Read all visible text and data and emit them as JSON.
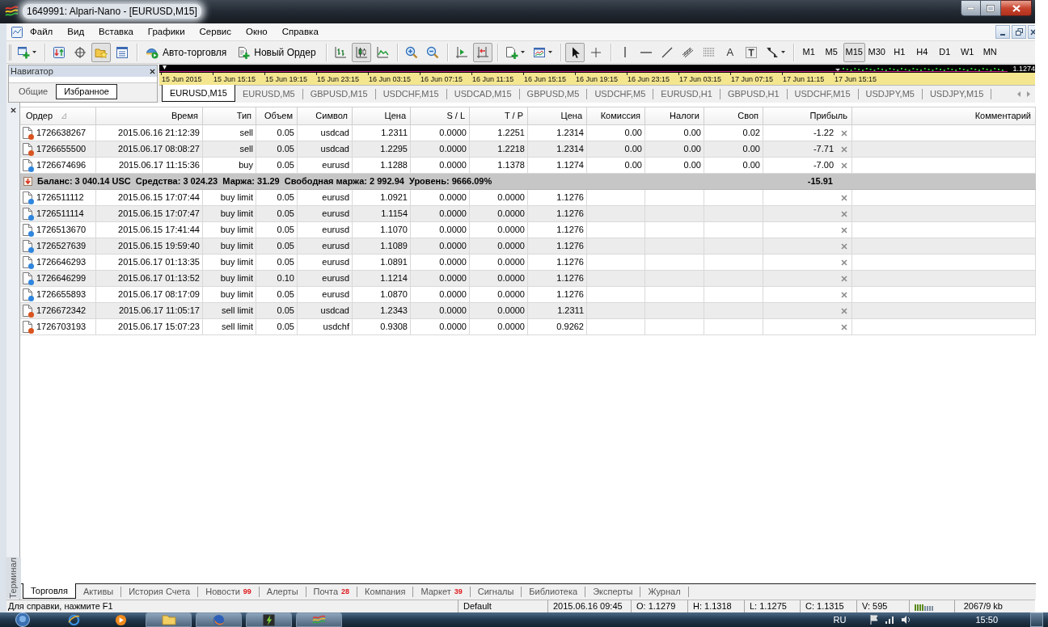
{
  "window": {
    "title": "1649991: Alpari-Nano - [EURUSD,M15]"
  },
  "menu": [
    "Файл",
    "Вид",
    "Вставка",
    "Графики",
    "Сервис",
    "Окно",
    "Справка"
  ],
  "toolbar": {
    "groups": [
      [
        {
          "kind": "icon",
          "pressed": false,
          "dropdown": true
        }
      ],
      [
        {
          "kind": "icon",
          "pressed": false,
          "dropdown": false
        },
        {
          "kind": "icon",
          "pressed": false,
          "dropdown": false
        },
        {
          "kind": "icon",
          "pressed": true,
          "dropdown": false
        },
        {
          "kind": "icon",
          "pressed": false,
          "dropdown": false
        }
      ],
      [
        {
          "kind": "text",
          "label": "Авто-торговля",
          "pressed": false
        },
        {
          "kind": "text",
          "label": "Новый Ордер",
          "pressed": false
        }
      ],
      [
        {
          "kind": "icon",
          "pressed": false,
          "dropdown": false
        },
        {
          "kind": "icon",
          "pressed": true,
          "dropdown": false
        },
        {
          "kind": "icon",
          "pressed": false,
          "dropdown": false
        }
      ],
      [
        {
          "kind": "icon",
          "pressed": false,
          "dropdown": false
        },
        {
          "kind": "icon",
          "pressed": false,
          "dropdown": false
        }
      ],
      [
        {
          "kind": "icon",
          "pressed": false,
          "dropdown": false
        },
        {
          "kind": "icon",
          "pressed": true,
          "dropdown": false
        }
      ],
      [
        {
          "kind": "icon",
          "pressed": false,
          "dropdown": true
        },
        {
          "kind": "icon",
          "pressed": false,
          "dropdown": true
        }
      ],
      [
        {
          "kind": "icon",
          "pressed": true,
          "dropdown": false
        },
        {
          "kind": "icon",
          "pressed": false,
          "dropdown": false
        }
      ],
      [
        {
          "kind": "icon",
          "pressed": false,
          "dropdown": false
        },
        {
          "kind": "icon",
          "pressed": false,
          "dropdown": false
        },
        {
          "kind": "icon",
          "pressed": false,
          "dropdown": false
        },
        {
          "kind": "icon",
          "pressed": false,
          "dropdown": false
        },
        {
          "kind": "icon",
          "pressed": false,
          "dropdown": false
        },
        {
          "kind": "glyph",
          "label": "A",
          "pressed": false
        },
        {
          "kind": "icon",
          "pressed": false,
          "dropdown": false
        },
        {
          "kind": "icon",
          "pressed": false,
          "dropdown": true
        }
      ],
      [
        {
          "kind": "timeframe",
          "label": "M1",
          "selected": false
        },
        {
          "kind": "timeframe",
          "label": "M5",
          "selected": false
        },
        {
          "kind": "timeframe",
          "label": "M15",
          "selected": true
        },
        {
          "kind": "timeframe",
          "label": "M30",
          "selected": false
        },
        {
          "kind": "timeframe",
          "label": "H1",
          "selected": false
        },
        {
          "kind": "timeframe",
          "label": "H4",
          "selected": false
        },
        {
          "kind": "timeframe",
          "label": "D1",
          "selected": false
        },
        {
          "kind": "timeframe",
          "label": "W1",
          "selected": false
        },
        {
          "kind": "timeframe",
          "label": "MN",
          "selected": false
        }
      ]
    ]
  },
  "navigator": {
    "title": "Навигатор",
    "tabs": [
      {
        "label": "Общие",
        "selected": false
      },
      {
        "label": "Избранное",
        "selected": true
      }
    ]
  },
  "chart": {
    "price_label": "1.1274",
    "time_labels": [
      "15 Jun 2015",
      "15 Jun 15:15",
      "15 Jun 19:15",
      "15 Jun 23:15",
      "16 Jun 03:15",
      "16 Jun 07:15",
      "16 Jun 11:15",
      "16 Jun 15:15",
      "16 Jun 19:15",
      "16 Jun 23:15",
      "17 Jun 03:15",
      "17 Jun 07:15",
      "17 Jun 11:15",
      "17 Jun 15:15"
    ]
  },
  "chart_tabs": [
    {
      "label": "EURUSD,M15",
      "selected": true
    },
    {
      "label": "EURUSD,M5",
      "selected": false
    },
    {
      "label": "GBPUSD,M15",
      "selected": false
    },
    {
      "label": "USDCHF,M15",
      "selected": false
    },
    {
      "label": "USDCAD,M15",
      "selected": false
    },
    {
      "label": "GBPUSD,M5",
      "selected": false
    },
    {
      "label": "USDCHF,M5",
      "selected": false
    },
    {
      "label": "EURUSD,H1",
      "selected": false
    },
    {
      "label": "GBPUSD,H1",
      "selected": false
    },
    {
      "label": "USDCHF,M15",
      "selected": false
    },
    {
      "label": "USDJPY,M5",
      "selected": false
    },
    {
      "label": "USDJPY,M15",
      "selected": false
    }
  ],
  "terminal": {
    "title": "Терминал",
    "columns": [
      {
        "label": "Ордер",
        "sorted": true
      },
      {
        "label": "Время",
        "sorted": false
      },
      {
        "label": "Тип",
        "sorted": false
      },
      {
        "label": "Объем",
        "sorted": false
      },
      {
        "label": "Символ",
        "sorted": false
      },
      {
        "label": "Цена",
        "sorted": false
      },
      {
        "label": "S / L",
        "sorted": false
      },
      {
        "label": "T / P",
        "sorted": false
      },
      {
        "label": "Цена",
        "sorted": false
      },
      {
        "label": "Комиссия",
        "sorted": false
      },
      {
        "label": "Налоги",
        "sorted": false
      },
      {
        "label": "Своп",
        "sorted": false
      },
      {
        "label": "Прибыль",
        "sorted": false
      },
      {
        "label": "Комментарий",
        "sorted": false
      }
    ],
    "rows": [
      {
        "kind": "order",
        "color": "#d9541e",
        "cells": [
          "1726638267",
          "2015.06.16 21:12:39",
          "sell",
          "0.05",
          "usdcad",
          "1.2311",
          "0.0000",
          "1.2251",
          "1.2314",
          "0.00",
          "0.00",
          "0.02",
          "-1.22"
        ]
      },
      {
        "kind": "order",
        "color": "#d9541e",
        "cells": [
          "1726655500",
          "2015.06.17 08:08:27",
          "sell",
          "0.05",
          "usdcad",
          "1.2295",
          "0.0000",
          "1.2218",
          "1.2314",
          "0.00",
          "0.00",
          "0.00",
          "-7.71"
        ]
      },
      {
        "kind": "order",
        "color": "#2f86de",
        "cells": [
          "1726674696",
          "2015.06.17 11:15:36",
          "buy",
          "0.05",
          "eurusd",
          "1.1288",
          "0.0000",
          "1.1378",
          "1.1274",
          "0.00",
          "0.00",
          "0.00",
          "-7.00"
        ]
      },
      {
        "kind": "summary",
        "text": "Баланс: 3 040.14 USC  Средства: 3 024.23  Маржа: 31.29  Свободная маржа: 2 992.94  Уровень: 9666.09%",
        "profit": "-15.91"
      },
      {
        "kind": "order",
        "color": "#2f86de",
        "cells": [
          "1726511112",
          "2015.06.15 17:07:44",
          "buy limit",
          "0.05",
          "eurusd",
          "1.0921",
          "0.0000",
          "0.0000",
          "1.1276"
        ]
      },
      {
        "kind": "order",
        "color": "#2f86de",
        "cells": [
          "1726511114",
          "2015.06.15 17:07:47",
          "buy limit",
          "0.05",
          "eurusd",
          "1.1154",
          "0.0000",
          "0.0000",
          "1.1276"
        ]
      },
      {
        "kind": "order",
        "color": "#2f86de",
        "cells": [
          "1726513670",
          "2015.06.15 17:41:44",
          "buy limit",
          "0.05",
          "eurusd",
          "1.1070",
          "0.0000",
          "0.0000",
          "1.1276"
        ]
      },
      {
        "kind": "order",
        "color": "#2f86de",
        "cells": [
          "1726527639",
          "2015.06.15 19:59:40",
          "buy limit",
          "0.05",
          "eurusd",
          "1.1089",
          "0.0000",
          "0.0000",
          "1.1276"
        ]
      },
      {
        "kind": "order",
        "color": "#2f86de",
        "cells": [
          "1726646293",
          "2015.06.17 01:13:35",
          "buy limit",
          "0.05",
          "eurusd",
          "1.0891",
          "0.0000",
          "0.0000",
          "1.1276"
        ]
      },
      {
        "kind": "order",
        "color": "#2f86de",
        "cells": [
          "1726646299",
          "2015.06.17 01:13:52",
          "buy limit",
          "0.10",
          "eurusd",
          "1.1214",
          "0.0000",
          "0.0000",
          "1.1276"
        ]
      },
      {
        "kind": "order",
        "color": "#2f86de",
        "cells": [
          "1726655893",
          "2015.06.17 08:17:09",
          "buy limit",
          "0.05",
          "eurusd",
          "1.0870",
          "0.0000",
          "0.0000",
          "1.1276"
        ]
      },
      {
        "kind": "order",
        "color": "#d9541e",
        "cells": [
          "1726672342",
          "2015.06.17 11:05:17",
          "sell limit",
          "0.05",
          "usdcad",
          "1.2343",
          "0.0000",
          "0.0000",
          "1.2311"
        ]
      },
      {
        "kind": "order",
        "color": "#d9541e",
        "cells": [
          "1726703193",
          "2015.06.17 15:07:23",
          "sell limit",
          "0.05",
          "usdchf",
          "0.9308",
          "0.0000",
          "0.0000",
          "0.9262"
        ]
      }
    ],
    "tabs": [
      {
        "label": "Торговля",
        "selected": true
      },
      {
        "label": "Активы",
        "selected": false
      },
      {
        "label": "История Счета",
        "selected": false
      },
      {
        "label": "Новости",
        "badge": "99",
        "selected": false
      },
      {
        "label": "Алерты",
        "selected": false
      },
      {
        "label": "Почта",
        "badge": "28",
        "selected": false
      },
      {
        "label": "Компания",
        "selected": false
      },
      {
        "label": "Маркет",
        "badge": "39",
        "selected": false
      },
      {
        "label": "Сигналы",
        "selected": false
      },
      {
        "label": "Библиотека",
        "selected": false
      },
      {
        "label": "Эксперты",
        "selected": false
      },
      {
        "label": "Журнал",
        "selected": false
      }
    ]
  },
  "status_bar": {
    "help": "Для справки, нажмите F1",
    "profile": "Default",
    "cells": [
      "2015.06.16 09:45",
      "O: 1.1279",
      "H: 1.1318",
      "L: 1.1275",
      "C: 1.1315",
      "V: 595"
    ],
    "traffic": "2067/9 kb"
  },
  "taskbar": {
    "language": "RU",
    "clock": "15:50"
  }
}
